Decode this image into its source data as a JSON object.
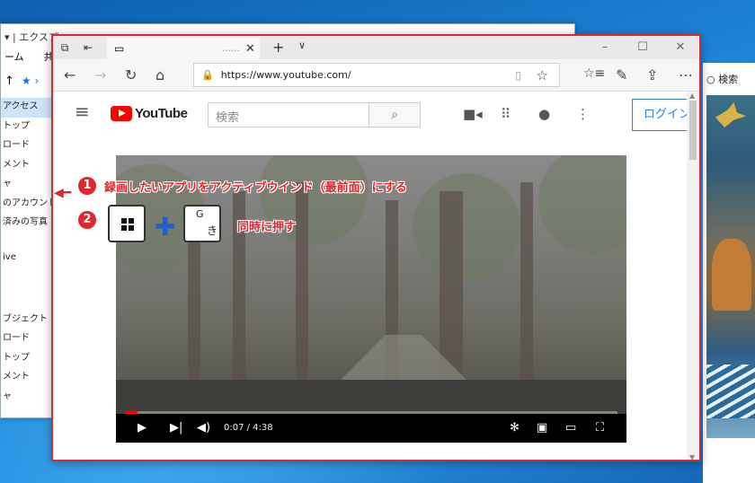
{
  "explorer": {
    "title": "▾ | エクスプ",
    "ribbon": [
      "ーム",
      "共有"
    ],
    "address_arrow": "↑",
    "nav_items": [
      "アクセス",
      "トップ",
      "ロード",
      "メント",
      "ャ",
      "のアカウントの",
      "済みの写真",
      "",
      "ive",
      "",
      "",
      "ブジェクト",
      "ロード",
      "トップ",
      "メント",
      "ャ"
    ]
  },
  "right": {
    "search_label": "検索"
  },
  "browser": {
    "tab_title": "……",
    "url": "https://www.youtube.com/",
    "window_controls": [
      "–",
      "☐",
      "✕"
    ]
  },
  "youtube": {
    "logo_text": "YouTube",
    "search_placeholder": "検索",
    "login_label": "ログイン"
  },
  "player": {
    "time_display": "0:07 / 4:38",
    "progress": 0.025
  },
  "annotation": {
    "step1_number": "1",
    "step1_text": "録画したいアプリをアクティブウインド（最前面）にする",
    "step2_number": "2",
    "step2_text": "同時に押す",
    "key_g": "G",
    "key_ki": "き"
  }
}
